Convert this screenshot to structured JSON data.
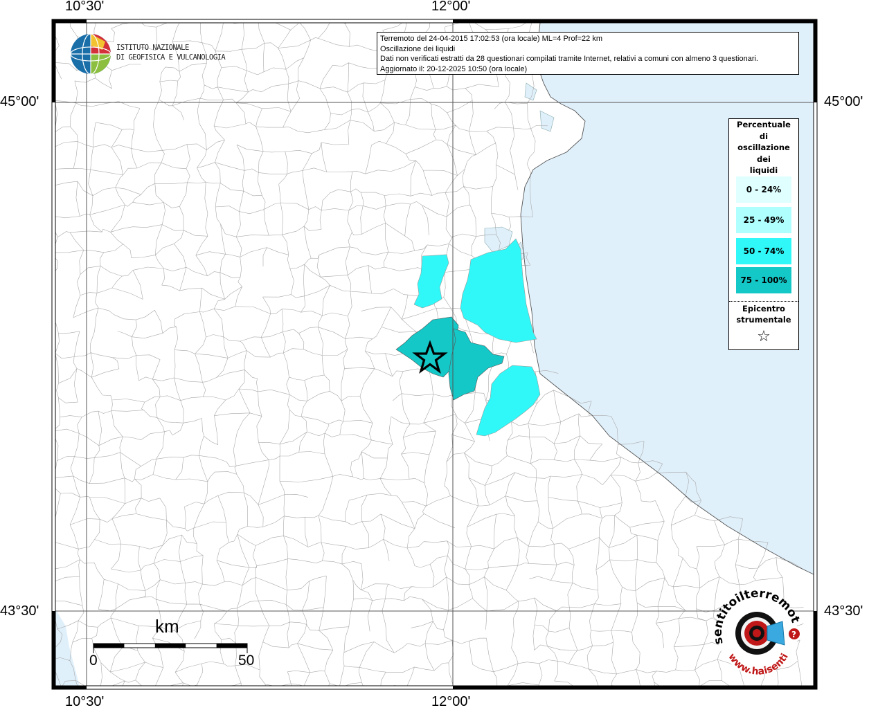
{
  "axis_labels": {
    "top": [
      "10°30'",
      "12°00'"
    ],
    "bottom": [
      "10°30'",
      "12°00'"
    ],
    "left": [
      "45°00'",
      "43°30'"
    ],
    "right": [
      "45°00'",
      "43°30'"
    ]
  },
  "info": {
    "line1": "Terremoto del 24-04-2015 17:02:53 (ora locale) ML=4 Prof=22 km",
    "line2": "Oscillazione dei liquidi",
    "line3": "Dati non verificati estratti da 28 questionari compilati tramite Internet, relativi a comuni con almeno 3 questionari.",
    "line4": "Aggiornato il: 20-12-2025 10:50 (ora locale)"
  },
  "logo": {
    "line1": "ISTITUTO NAZIONALE",
    "line2": "DI GEOFISICA E VULCANOLOGIA"
  },
  "legend": {
    "title_lines": [
      "Percentuale",
      "di",
      "oscillazione",
      "dei",
      "liquidi"
    ],
    "classes": [
      {
        "label": "0 - 24%",
        "color": "#e0ffff"
      },
      {
        "label": "25 - 49%",
        "color": "#b0ffff"
      },
      {
        "label": "50 - 74%",
        "color": "#30f8f8"
      },
      {
        "label": "75 - 100%",
        "color": "#14c8c8"
      }
    ],
    "epicenter_lines": [
      "Epicentro",
      "strumentale"
    ],
    "epicenter_symbol": "☆"
  },
  "scale": {
    "title": "km",
    "start": "0",
    "end": "50"
  },
  "sea_color": "#e0f0fb",
  "branding": {
    "top_text": "sentitoilterremoto.it",
    "bottom_text": "www.haisentito",
    "question": "?"
  }
}
